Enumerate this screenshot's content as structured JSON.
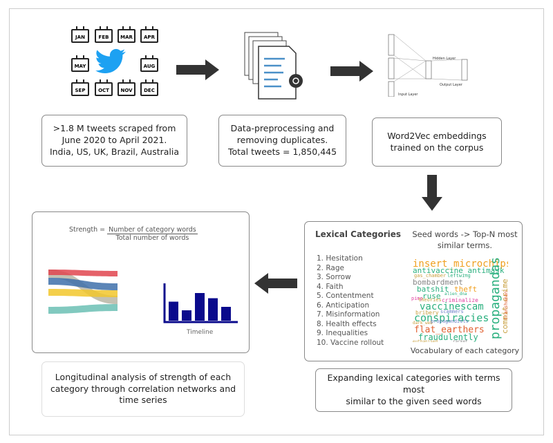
{
  "step1": {
    "months": [
      "JAN",
      "FEB",
      "MAR",
      "APR",
      "MAY",
      "AUG",
      "SEP",
      "OCT",
      "NOV",
      "DEC"
    ],
    "icon": "twitter-bird-icon",
    "text_lines": [
      ">1.8 M tweets scraped from",
      "June 2020 to April 2021.",
      "India, US, UK, Brazil, Australia"
    ]
  },
  "step2": {
    "icon": "documents-processing-icon",
    "text_lines": [
      "Data-preprocessing and",
      "removing duplicates.",
      "Total tweets = 1,850,445"
    ]
  },
  "step3": {
    "labels": {
      "hidden": "Hidden Layer",
      "output": "Output Layer",
      "input": "Input Layer"
    },
    "text_lines": [
      "Word2Vec embeddings",
      "trained on the corpus"
    ]
  },
  "step4": {
    "title": "Lexical Categories",
    "categories": [
      "1. Hesitation",
      "2. Rage",
      "3. Sorrow",
      "4. Faith",
      "5. Contentment",
      "6. Anticipation",
      "7. Misinformation",
      "8. Health effects",
      "9. Inequalities",
      "10. Vaccine rollout"
    ],
    "seed_caption": "Seed words -> Top-N most similar terms.",
    "cloud_caption": "Vocabulary of each category",
    "cloud_words": [
      "insert_microchips",
      "antivaccine_antimask",
      "gas_chamber",
      "leftwing",
      "bombardment",
      "batshit",
      "theft",
      "ruse",
      "alien_dna",
      "pimp",
      "theories",
      "criminalize",
      "vaccinescam",
      "bribery",
      "scammers",
      "conspiracies",
      "dark_web",
      "propagandists",
      "flat_earthers",
      "fraudulently",
      "euthanised",
      "racket",
      "propagandas",
      "commit_crime",
      "transhuman"
    ],
    "description_lines": [
      "Expanding lexical categories with terms most",
      "similar to the given seed words"
    ]
  },
  "step5": {
    "formula_lhs": "Strength = ",
    "numerator": "Number of category words",
    "denominator": "Total number of words",
    "timeline_label": "Timeline",
    "timeline_bars": [
      0.55,
      0.3,
      0.8,
      0.65,
      0.4
    ],
    "description_lines": [
      "Longitudinal analysis of strength of each",
      "category through correlation networks and",
      "time series"
    ]
  },
  "colors": {
    "arrow": "#333333",
    "twitter": "#1da1f2",
    "bars": "#0a0a8c",
    "sankey": [
      "#e0454f",
      "#3e70aa",
      "#f2c72c",
      "#6bbfb4",
      "#b8b6a4"
    ]
  }
}
